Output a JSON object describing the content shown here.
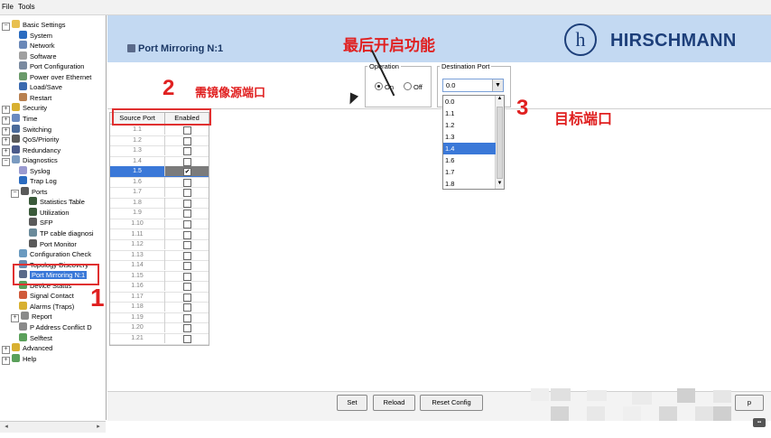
{
  "menubar": {
    "file": "File",
    "tools": "Tools"
  },
  "tree": [
    {
      "label": "Basic Settings",
      "indent": 1,
      "expander": "⊟",
      "color": "#e8c050"
    },
    {
      "label": "System",
      "indent": 2,
      "color": "#2a6bc0"
    },
    {
      "label": "Network",
      "indent": 2,
      "color": "#6a88b8"
    },
    {
      "label": "Software",
      "indent": 2,
      "color": "#a0a0a0"
    },
    {
      "label": "Port Configuration",
      "indent": 2,
      "color": "#7a8aa0"
    },
    {
      "label": "Power over Ethernet",
      "indent": 2,
      "color": "#6a9a6a"
    },
    {
      "label": "Load/Save",
      "indent": 2,
      "color": "#3a6ab0"
    },
    {
      "label": "Restart",
      "indent": 2,
      "color": "#b88050"
    },
    {
      "label": "Security",
      "indent": 1,
      "expander": "⊞",
      "color": "#d8b030"
    },
    {
      "label": "Time",
      "indent": 1,
      "expander": "⊞",
      "color": "#6a8ac0"
    },
    {
      "label": "Switching",
      "indent": 1,
      "expander": "⊞",
      "color": "#4a6a9a"
    },
    {
      "label": "QoS/Priority",
      "indent": 1,
      "expander": "⊞",
      "color": "#5a5a5a"
    },
    {
      "label": "Redundancy",
      "indent": 1,
      "expander": "⊞",
      "color": "#4a5a8a"
    },
    {
      "label": "Diagnostics",
      "indent": 1,
      "expander": "⊟",
      "color": "#7a9ac0"
    },
    {
      "label": "Syslog",
      "indent": 2,
      "color": "#9a9ad0"
    },
    {
      "label": "Trap Log",
      "indent": 2,
      "color": "#2a6bc0"
    },
    {
      "label": "Ports",
      "indent": 2,
      "expander": "⊟",
      "color": "#5a5a5a"
    },
    {
      "label": "Statistics Table",
      "indent": 3,
      "color": "#3a5a3a"
    },
    {
      "label": "Utilization",
      "indent": 3,
      "color": "#3a5a3a"
    },
    {
      "label": "SFP",
      "indent": 3,
      "color": "#5a5a5a"
    },
    {
      "label": "TP cable diagnosi",
      "indent": 3,
      "color": "#6a8a9a"
    },
    {
      "label": "Port Monitor",
      "indent": 3,
      "color": "#5a5a5a"
    },
    {
      "label": "Configuration Check",
      "indent": 2,
      "color": "#6a9ac0"
    },
    {
      "label": "Topology Discovery",
      "indent": 2,
      "color": "#6a8ab0"
    },
    {
      "label": "Port Mirroring N:1",
      "indent": 2,
      "color": "#5a6a8a",
      "selected": true
    },
    {
      "label": "Device Status",
      "indent": 2,
      "color": "#5aa05a"
    },
    {
      "label": "Signal Contact",
      "indent": 2,
      "color": "#d05a3a"
    },
    {
      "label": "Alarms (Traps)",
      "indent": 2,
      "color": "#d8b030"
    },
    {
      "label": "Report",
      "indent": 2,
      "expander": "⊞",
      "color": "#8a8a8a"
    },
    {
      "label": "P Address Conflict D",
      "indent": 2,
      "color": "#8a8a8a"
    },
    {
      "label": "Selftest",
      "indent": 2,
      "color": "#5aa05a"
    },
    {
      "label": "Advanced",
      "indent": 1,
      "expander": "⊞",
      "color": "#d8b030"
    },
    {
      "label": "Help",
      "indent": 1,
      "expander": "⊞",
      "color": "#5aa05a"
    }
  ],
  "scroll": {
    "left": "◂",
    "right": "▸"
  },
  "header": {
    "title": "Port Mirroring N:1",
    "logo_mark": "h",
    "brand": "HIRSCHMANN"
  },
  "operation": {
    "legend": "Operation",
    "on": "On",
    "off": "Off",
    "selected": "On"
  },
  "destination": {
    "legend": "Destination Port",
    "value": "0.0",
    "options": [
      "0.0",
      "1.1",
      "1.2",
      "1.3",
      "1.4",
      "1.6",
      "1.7",
      "1.8"
    ],
    "highlighted": "1.4"
  },
  "table": {
    "headers": [
      "Source Port",
      "Enabled"
    ],
    "rows": [
      {
        "port": "1.1",
        "enabled": false
      },
      {
        "port": "1.2",
        "enabled": false
      },
      {
        "port": "1.3",
        "enabled": false
      },
      {
        "port": "1.4",
        "enabled": false
      },
      {
        "port": "1.5",
        "enabled": true,
        "selected": true
      },
      {
        "port": "1.6",
        "enabled": false
      },
      {
        "port": "1.7",
        "enabled": false
      },
      {
        "port": "1.8",
        "enabled": false
      },
      {
        "port": "1.9",
        "enabled": false
      },
      {
        "port": "1.10",
        "enabled": false
      },
      {
        "port": "1.11",
        "enabled": false
      },
      {
        "port": "1.12",
        "enabled": false
      },
      {
        "port": "1.13",
        "enabled": false
      },
      {
        "port": "1.14",
        "enabled": false
      },
      {
        "port": "1.15",
        "enabled": false
      },
      {
        "port": "1.16",
        "enabled": false
      },
      {
        "port": "1.17",
        "enabled": false
      },
      {
        "port": "1.18",
        "enabled": false
      },
      {
        "port": "1.19",
        "enabled": false
      },
      {
        "port": "1.20",
        "enabled": false
      },
      {
        "port": "1.21",
        "enabled": false
      }
    ]
  },
  "buttons": {
    "set": "Set",
    "reload": "Reload",
    "reset": "Reset Config",
    "partial": "p"
  },
  "annotations": {
    "n1": "1",
    "n2": "2",
    "n2_text": "需镜像源端口",
    "n3": "3",
    "n3_text": "目标端口",
    "top_text": "最后开启功能"
  },
  "colors": {
    "accent": "#3a78d8",
    "header_bg": "#c3d9f2",
    "brand": "#1d3f7a",
    "annotation": "#e02020"
  }
}
